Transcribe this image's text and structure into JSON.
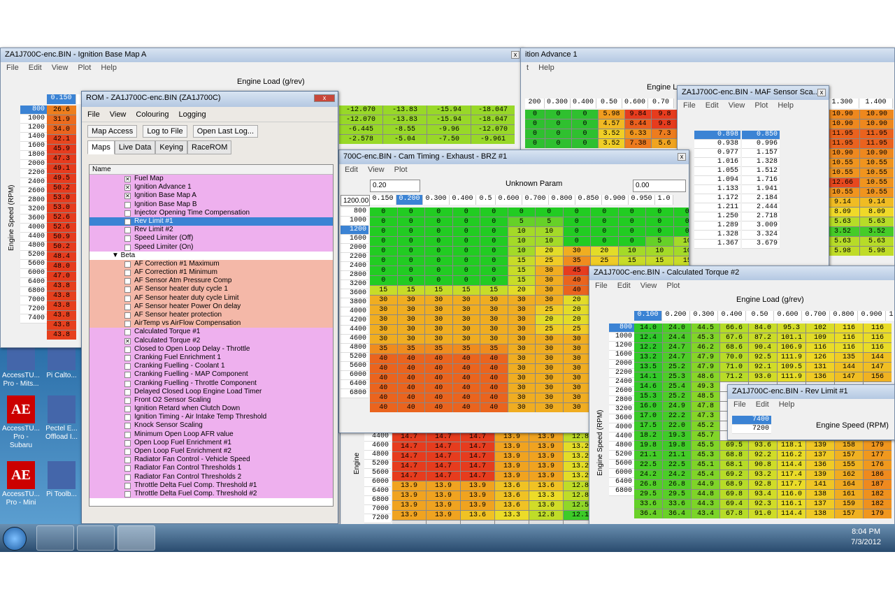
{
  "rom": {
    "title": "ROM - ZA1J700C-enc.BIN (ZA1J700C)",
    "menu": [
      "File",
      "View",
      "Colouring",
      "Logging"
    ],
    "tools": [
      "Map Access",
      "Log to File",
      "Open Last Log..."
    ],
    "tabs": [
      "Maps",
      "Live Data",
      "Keying",
      "RaceROM"
    ],
    "col_name": "Name",
    "items": [
      {
        "t": "Fuel Map",
        "c": "pink",
        "x": "✕"
      },
      {
        "t": "Ignition Advance 1",
        "c": "pink",
        "x": "✕"
      },
      {
        "t": "Ignition Base Map A",
        "c": "pink",
        "x": "✕"
      },
      {
        "t": "Ignition Base Map B",
        "c": "pink",
        "x": ""
      },
      {
        "t": "Injector Opening Time Compensation",
        "c": "pink",
        "x": ""
      },
      {
        "t": "Rev Limit #1",
        "c": "sel",
        "x": "✕"
      },
      {
        "t": "Rev Limit #2",
        "c": "pink",
        "x": ""
      },
      {
        "t": "Speed Limiter (Off)",
        "c": "pink",
        "x": ""
      },
      {
        "t": "Speed Limiter (On)",
        "c": "pink",
        "x": ""
      },
      {
        "t": "▼ Beta",
        "c": "cat",
        "x": null
      },
      {
        "t": "AF Correction #1 Maximum",
        "c": "sal",
        "x": ""
      },
      {
        "t": "AF Correction #1 Minimum",
        "c": "sal",
        "x": ""
      },
      {
        "t": "AF Sensor Atm Pressure Comp",
        "c": "sal",
        "x": ""
      },
      {
        "t": "AF Sensor heater duty cycle 1",
        "c": "sal",
        "x": ""
      },
      {
        "t": "AF Sensor heater duty cycle Limit",
        "c": "sal",
        "x": ""
      },
      {
        "t": "AF Sensor heater Power On delay",
        "c": "sal",
        "x": ""
      },
      {
        "t": "AF Sensor heater protection",
        "c": "sal",
        "x": ""
      },
      {
        "t": "AirTemp vs AirFlow Compensation",
        "c": "sal",
        "x": ""
      },
      {
        "t": "Calculated Torque #1",
        "c": "pink",
        "x": ""
      },
      {
        "t": "Calculated Torque #2",
        "c": "pink",
        "x": "✕"
      },
      {
        "t": "Closed to Open Loop Delay - Throttle",
        "c": "pink",
        "x": ""
      },
      {
        "t": "Cranking Fuel Enrichment 1",
        "c": "pink",
        "x": ""
      },
      {
        "t": "Cranking Fuelling - Coolant 1",
        "c": "pink",
        "x": ""
      },
      {
        "t": "Cranking Fuelling - MAP Component",
        "c": "pink",
        "x": ""
      },
      {
        "t": "Cranking Fuelling - Throttle Component",
        "c": "pink",
        "x": ""
      },
      {
        "t": "Delayed Closed Loop Engine Load Timer",
        "c": "pink",
        "x": ""
      },
      {
        "t": "Front O2 Sensor Scaling",
        "c": "pink",
        "x": ""
      },
      {
        "t": "Ignition Retard when Clutch Down",
        "c": "pink",
        "x": ""
      },
      {
        "t": "Ignition Timing - Air Intake Temp Threshold",
        "c": "pink",
        "x": ""
      },
      {
        "t": "Knock Sensor Scaling",
        "c": "pink",
        "x": ""
      },
      {
        "t": "Minimum Open Loop AFR value",
        "c": "pink",
        "x": ""
      },
      {
        "t": "Open Loop Fuel Enrichment #1",
        "c": "pink",
        "x": ""
      },
      {
        "t": "Open Loop Fuel Enrichment #2",
        "c": "pink",
        "x": ""
      },
      {
        "t": "Radiator Fan Control - Vehicle Speed",
        "c": "pink",
        "x": ""
      },
      {
        "t": "Radiator Fan Control Thresholds 1",
        "c": "pink",
        "x": ""
      },
      {
        "t": "Radiator Fan Control Thresholds 2",
        "c": "pink",
        "x": ""
      },
      {
        "t": "Throttle Delta Fuel Comp. Threshold #1",
        "c": "pink",
        "x": ""
      },
      {
        "t": "Throttle Delta Fuel Comp. Threshold #2",
        "c": "pink",
        "x": ""
      }
    ]
  },
  "ign": {
    "title": "ZA1J700C-enc.BIN - Ignition Base Map A",
    "menu": [
      "File",
      "Edit",
      "View",
      "Plot",
      "Help"
    ],
    "xlabel": "Engine Load (g/rev)",
    "ylabel": "Engine Speed (RPM)",
    "cols": [
      "0.150",
      "1.10000",
      "1.2000",
      "1.3000",
      "1.40000"
    ],
    "rows": [
      "800",
      "1000",
      "1200",
      "1400",
      "1600",
      "1800",
      "2000",
      "2200",
      "2400",
      "2600",
      "2800",
      "3200",
      "3600",
      "4000",
      "4400",
      "4800",
      "5200",
      "5600",
      "6000",
      "6400",
      "6800",
      "7000",
      "7200",
      "7400"
    ],
    "first": [
      "26.6",
      "31.9",
      "34.0",
      "42.1",
      "45.9",
      "47.3",
      "49.1",
      "49.5",
      "50.2",
      "53.0",
      "53.0",
      "52.6",
      "52.6",
      "50.9",
      "50.2",
      "48.4",
      "48.0",
      "47.0",
      "43.8",
      "43.8",
      "43.8",
      "43.8",
      "43.8",
      "43.8"
    ],
    "right": [
      [
        "-12.070",
        "-13.83",
        "-15.94",
        "-18.047"
      ],
      [
        "-12.070",
        "-13.83",
        "-15.94",
        "-18.047"
      ],
      [
        "-6.445",
        "-8.55",
        "-9.96",
        "-12.070"
      ],
      [
        "-2.578",
        "-5.04",
        "-7.50",
        "-9.961"
      ]
    ]
  },
  "ignadv": {
    "title": "ition Advance 1",
    "menu": [
      "t",
      "Help"
    ],
    "xlabel": "Engine L",
    "cols": [
      "200",
      "0.300",
      "0.400",
      "0.50",
      "0.600",
      "0.70"
    ],
    "cells": [
      [
        "0",
        "0",
        "0",
        "5.98",
        "9.84",
        "9.8"
      ],
      [
        "0",
        "0",
        "0",
        "4.57",
        "8.44",
        "9.8"
      ],
      [
        "0",
        "0",
        "0",
        "3.52",
        "6.33",
        "7.3"
      ],
      [
        "0",
        "0",
        "0",
        "3.52",
        "7.38",
        "5.6"
      ]
    ]
  },
  "maf": {
    "title": "ZA1J700C-enc.BIN - MAF Sensor Sca...",
    "menu": [
      "File",
      "Edit",
      "View",
      "Plot",
      "Help"
    ],
    "a": [
      "0.898",
      "0.938",
      "0.977",
      "1.016",
      "1.055",
      "1.094",
      "1.133",
      "1.172",
      "1.211",
      "1.250",
      "1.289",
      "1.328",
      "1.367"
    ],
    "b": [
      "0.850",
      "0.996",
      "1.157",
      "1.328",
      "1.512",
      "1.716",
      "1.941",
      "2.184",
      "2.444",
      "2.718",
      "3.009",
      "3.324",
      "3.679"
    ]
  },
  "farright": {
    "cols": [
      "1.300",
      "1.400"
    ],
    "cells": [
      [
        "10.90",
        "10.90"
      ],
      [
        "10.90",
        "10.90"
      ],
      [
        "11.95",
        "11.95"
      ],
      [
        "11.95",
        "11.95"
      ],
      [
        "10.90",
        "10.90"
      ],
      [
        "10.55",
        "10.55"
      ],
      [
        "10.55",
        "10.55"
      ],
      [
        "12.66",
        "10.55"
      ],
      [
        "10.55",
        "10.55"
      ],
      [
        "9.14",
        "9.14"
      ],
      [
        "8.09",
        "8.09"
      ],
      [
        "5.63",
        "5.63"
      ],
      [
        "3.52",
        "3.52"
      ],
      [
        "5.63",
        "5.63"
      ],
      [
        "5.98",
        "5.98"
      ]
    ]
  },
  "cam": {
    "title": "700C-enc.BIN - Cam Timing - Exhaust - BRZ #1",
    "menu": [
      "Edit",
      "View",
      "Plot"
    ],
    "in_left": "0.20",
    "label": "Unknown Param",
    "in_right": "0.00",
    "corner": "1200.00",
    "cols": [
      "0.150",
      "0.200",
      "0.300",
      "0.400",
      "0.5",
      "0.600",
      "0.700",
      "0.800",
      "0.850",
      "0.900",
      "0.950",
      "1.0"
    ],
    "rows": [
      "800",
      "1000",
      "1200",
      "1600",
      "2000",
      "2200",
      "2400",
      "2800",
      "3200",
      "3600",
      "3800",
      "4000",
      "4200",
      "4400",
      "4600",
      "4800",
      "5200",
      "5600",
      "6000",
      "6400",
      "6800"
    ],
    "cells": [
      [
        "0",
        "0",
        "0",
        "0",
        "0",
        "0",
        "0",
        "0",
        "0",
        "0",
        "0",
        "0"
      ],
      [
        "0",
        "0",
        "0",
        "0",
        "0",
        "5",
        "5",
        "0",
        "0",
        "0",
        "0",
        "0"
      ],
      [
        "0",
        "0",
        "0",
        "0",
        "0",
        "10",
        "10",
        "0",
        "0",
        "0",
        "0",
        "0"
      ],
      [
        "0",
        "0",
        "0",
        "0",
        "0",
        "10",
        "10",
        "0",
        "0",
        "0",
        "5",
        "10"
      ],
      [
        "0",
        "0",
        "0",
        "0",
        "0",
        "10",
        "20",
        "30",
        "20",
        "10",
        "10",
        "10"
      ],
      [
        "0",
        "0",
        "0",
        "0",
        "0",
        "15",
        "25",
        "35",
        "25",
        "15",
        "15",
        "15"
      ],
      [
        "0",
        "0",
        "0",
        "0",
        "0",
        "15",
        "30",
        "45",
        "",
        "",
        "",
        ""
      ],
      [
        "0",
        "0",
        "0",
        "0",
        "0",
        "15",
        "30",
        "40",
        "",
        "",
        "",
        ""
      ],
      [
        "15",
        "15",
        "15",
        "15",
        "15",
        "20",
        "30",
        "40",
        "",
        "",
        "",
        ""
      ],
      [
        "30",
        "30",
        "30",
        "30",
        "30",
        "30",
        "30",
        "20",
        "",
        "",
        "",
        ""
      ],
      [
        "30",
        "30",
        "30",
        "30",
        "30",
        "30",
        "25",
        "20",
        "",
        "",
        "",
        ""
      ],
      [
        "30",
        "30",
        "30",
        "30",
        "30",
        "30",
        "20",
        "20",
        "",
        "",
        "",
        ""
      ],
      [
        "30",
        "30",
        "30",
        "30",
        "30",
        "30",
        "25",
        "25",
        "",
        "",
        "",
        ""
      ],
      [
        "30",
        "30",
        "30",
        "30",
        "30",
        "30",
        "30",
        "30",
        "",
        "",
        "",
        ""
      ],
      [
        "35",
        "35",
        "35",
        "35",
        "35",
        "30",
        "30",
        "30",
        "",
        "",
        "",
        ""
      ],
      [
        "40",
        "40",
        "40",
        "40",
        "40",
        "30",
        "30",
        "30",
        "",
        "",
        "",
        ""
      ],
      [
        "40",
        "40",
        "40",
        "40",
        "40",
        "30",
        "30",
        "30",
        "",
        "",
        "",
        ""
      ],
      [
        "40",
        "40",
        "40",
        "40",
        "40",
        "30",
        "30",
        "30",
        "",
        "",
        "",
        ""
      ],
      [
        "40",
        "40",
        "40",
        "40",
        "40",
        "30",
        "30",
        "30",
        "",
        "",
        "",
        ""
      ],
      [
        "40",
        "40",
        "40",
        "40",
        "40",
        "30",
        "30",
        "30",
        "",
        "",
        "",
        ""
      ],
      [
        "40",
        "40",
        "40",
        "40",
        "40",
        "30",
        "30",
        "30",
        "",
        "",
        "",
        ""
      ]
    ]
  },
  "fuel": {
    "rows": [
      "4400",
      "4600",
      "4800",
      "5200",
      "5600",
      "6000",
      "6400",
      "6800",
      "7000",
      "7200"
    ],
    "cells": [
      [
        "14.7",
        "14.7",
        "14.7",
        "13.9",
        "13.9",
        "12.8"
      ],
      [
        "14.7",
        "14.7",
        "14.7",
        "13.9",
        "13.9",
        "13.2"
      ],
      [
        "14.7",
        "14.7",
        "14.7",
        "13.9",
        "13.9",
        "13.2"
      ],
      [
        "14.7",
        "14.7",
        "14.7",
        "13.9",
        "13.9",
        "13.2"
      ],
      [
        "14.7",
        "14.7",
        "14.7",
        "13.9",
        "13.9",
        "13.2"
      ],
      [
        "13.9",
        "13.9",
        "13.9",
        "13.6",
        "13.6",
        "12.8"
      ],
      [
        "13.9",
        "13.9",
        "13.9",
        "13.6",
        "13.3",
        "12.8"
      ],
      [
        "13.9",
        "13.9",
        "13.9",
        "13.6",
        "13.0",
        "12.5"
      ],
      [
        "13.9",
        "13.9",
        "13.6",
        "13.3",
        "12.8",
        "12.1"
      ],
      [
        "",
        "",
        "",
        "",
        "",
        ""
      ]
    ],
    "ylabel": "Engine"
  },
  "torq": {
    "title": "ZA1J700C-enc.BIN - Calculated Torque #2",
    "menu": [
      "File",
      "Edit",
      "View",
      "Plot"
    ],
    "xlabel": "Engine Load (g/rev)",
    "ylabel": "Engine Speed (RPM)",
    "cols": [
      "0.100",
      "0.200",
      "0.300",
      "0.400",
      "0.50",
      "0.600",
      "0.700",
      "0.800",
      "0.900",
      "1"
    ],
    "rows": [
      "800",
      "1000",
      "1200",
      "1600",
      "2000",
      "2200",
      "2400",
      "2600",
      "2800",
      "3200",
      "3600",
      "4000",
      "4400",
      "4800",
      "5200",
      "5600",
      "6000",
      "6400",
      "6800"
    ],
    "cells": [
      [
        "14.0",
        "24.0",
        "44.5",
        "66.6",
        "84.0",
        "95.3",
        "102",
        "116",
        "116"
      ],
      [
        "12.4",
        "24.4",
        "45.3",
        "67.6",
        "87.2",
        "101.1",
        "109",
        "116",
        "116"
      ],
      [
        "12.2",
        "24.7",
        "46.2",
        "68.6",
        "90.4",
        "106.9",
        "116",
        "116",
        "116"
      ],
      [
        "13.2",
        "24.7",
        "47.9",
        "70.0",
        "92.5",
        "111.9",
        "126",
        "135",
        "144"
      ],
      [
        "13.5",
        "25.2",
        "47.9",
        "71.0",
        "92.1",
        "109.5",
        "131",
        "144",
        "147"
      ],
      [
        "14.1",
        "25.3",
        "48.6",
        "71.2",
        "93.0",
        "111.9",
        "136",
        "147",
        "156"
      ],
      [
        "14.6",
        "25.4",
        "49.3",
        "",
        "",
        "",
        "",
        "",
        ""
      ],
      [
        "15.3",
        "25.2",
        "48.5",
        "",
        "",
        "",
        "",
        "",
        ""
      ],
      [
        "16.0",
        "24.9",
        "47.8",
        "",
        "",
        "",
        "",
        "",
        ""
      ],
      [
        "17.0",
        "22.2",
        "47.3",
        "",
        "",
        "",
        "",
        "",
        ""
      ],
      [
        "17.5",
        "22.0",
        "45.2",
        "",
        "",
        "",
        "",
        "",
        ""
      ],
      [
        "18.2",
        "19.3",
        "45.7",
        "",
        "",
        "",
        "",
        "",
        ""
      ],
      [
        "19.8",
        "19.8",
        "45.5",
        "69.5",
        "93.6",
        "118.1",
        "139",
        "158",
        "179"
      ],
      [
        "21.1",
        "21.1",
        "45.3",
        "68.8",
        "92.2",
        "116.2",
        "137",
        "157",
        "177"
      ],
      [
        "22.5",
        "22.5",
        "45.1",
        "68.1",
        "90.8",
        "114.4",
        "136",
        "155",
        "176"
      ],
      [
        "24.2",
        "24.2",
        "45.4",
        "69.2",
        "93.2",
        "117.4",
        "139",
        "162",
        "186"
      ],
      [
        "26.8",
        "26.8",
        "44.9",
        "68.9",
        "92.8",
        "117.7",
        "141",
        "164",
        "187"
      ],
      [
        "29.5",
        "29.5",
        "44.8",
        "69.8",
        "93.4",
        "116.0",
        "138",
        "161",
        "182"
      ],
      [
        "33.6",
        "33.6",
        "44.3",
        "69.4",
        "92.3",
        "116.1",
        "137",
        "159",
        "182"
      ],
      [
        "36.4",
        "36.4",
        "43.4",
        "67.8",
        "91.0",
        "114.4",
        "138",
        "157",
        "179"
      ]
    ]
  },
  "rev": {
    "title": "ZA1J700C-enc.BIN - Rev Limit #1",
    "menu": [
      "File",
      "Edit",
      "Help"
    ],
    "vals": [
      "7400",
      "7200"
    ],
    "label": "Engine Speed (RPM)"
  },
  "desktop": [
    {
      "l": "AccessTU... Pro - Mits...",
      "i": ""
    },
    {
      "l": "Pi Calto...",
      "i": ""
    },
    {
      "l": "AccessTU... Pro - Subaru",
      "i": "AE"
    },
    {
      "l": "Pectel E... Offload I...",
      "i": ""
    },
    {
      "l": "AccessTU... Pro - Mini",
      "i": "AE"
    },
    {
      "l": "Pi Toolb...",
      "i": ""
    }
  ],
  "tray": {
    "time": "8:04 PM",
    "date": "7/3/2012"
  },
  "close": "x"
}
